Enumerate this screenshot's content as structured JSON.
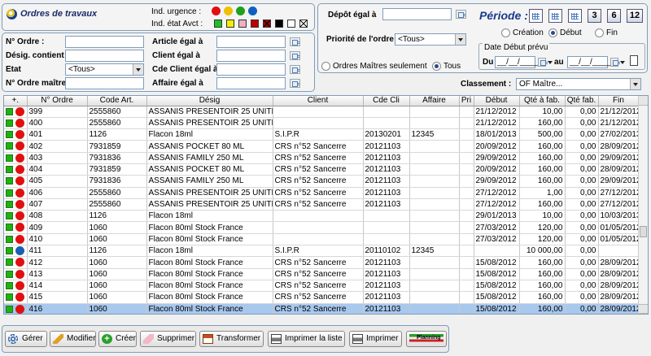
{
  "header": {
    "title": "Ordres de travaux",
    "urgence_label": "Ind. urgence :",
    "etat_label": "Ind. état Avct :",
    "urgence_colors": [
      "#e01010",
      "#f0c000",
      "#20a020",
      "#1060c0"
    ],
    "etat_colors": [
      "#20c020",
      "#f0f000",
      "#f0b0c0",
      "#c00000",
      "#a00000",
      "#000000",
      "#ffffff",
      "#ffffff"
    ]
  },
  "filters": {
    "ordre_label": "N° Ordre :",
    "desig_label": "Désig. contient",
    "etat_label": "Etat",
    "etat_value": "<Tous>",
    "ordre_maitre_label": "N° Ordre maître",
    "article_label": "Article égal à",
    "client_label": "Client égal à",
    "cde_client_label": "Cde Client égal à",
    "affaire_label": "Affaire égal à"
  },
  "depot": {
    "depot_label": "Dépôt égal à",
    "priorite_label": "Priorité de l'ordre :",
    "priorite_value": "<Tous>",
    "maitres_label": "Ordres Maîtres seulement",
    "tous_label": "Tous"
  },
  "periode": {
    "title": "Période :",
    "buttons": [
      "3",
      "6",
      "12"
    ],
    "creation_label": "Création",
    "debut_label": "Début",
    "fin_label": "Fin",
    "date_box_title": "Date Début prévu",
    "du_label": "Du",
    "au_label": "au",
    "du_value": "__/__/____",
    "au_value": "__/__/____"
  },
  "classement": {
    "label": "Classement :",
    "value": "OF Maître..."
  },
  "table": {
    "columns": [
      "+.",
      "N° Ordre",
      "Code Art.",
      "Désig",
      "Client",
      "Cde Cli",
      "Affaire",
      "Pri",
      "Début",
      "Qté à fab.",
      "Qté fab.",
      "Fin"
    ],
    "rows": [
      {
        "dot": "#e01010",
        "ordre": "399",
        "code": "2555860",
        "desig": "ASSANIS PRESENTOIR 25 UNITES",
        "client": "",
        "cde": "",
        "affaire": "",
        "pri": "",
        "debut": "21/12/2012",
        "qte": "10,00",
        "fab": "0,00",
        "fin": "21/12/2012"
      },
      {
        "dot": "#e01010",
        "ordre": "400",
        "code": "2555860",
        "desig": "ASSANIS PRESENTOIR 25 UNITES",
        "client": "",
        "cde": "",
        "affaire": "",
        "pri": "",
        "debut": "21/12/2012",
        "qte": "160,00",
        "fab": "0,00",
        "fin": "21/12/2012"
      },
      {
        "dot": "#e01010",
        "ordre": "401",
        "code": "1126",
        "desig": "Flacon 18ml",
        "client": "S.I.P.R",
        "cde": "20130201",
        "affaire": "12345",
        "pri": "",
        "debut": "18/01/2013",
        "qte": "500,00",
        "fab": "0,00",
        "fin": "27/02/2013"
      },
      {
        "dot": "#e01010",
        "ordre": "402",
        "code": "7931859",
        "desig": "ASSANIS POCKET 80 ML",
        "client": "CRS n°52 Sancerre",
        "cde": "20121103",
        "affaire": "",
        "pri": "",
        "debut": "20/09/2012",
        "qte": "160,00",
        "fab": "0,00",
        "fin": "28/09/2012"
      },
      {
        "dot": "#e01010",
        "ordre": "403",
        "code": "7931836",
        "desig": "ASSANIS FAMILY 250 ML",
        "client": "CRS n°52 Sancerre",
        "cde": "20121103",
        "affaire": "",
        "pri": "",
        "debut": "29/09/2012",
        "qte": "160,00",
        "fab": "0,00",
        "fin": "29/09/2012"
      },
      {
        "dot": "#e01010",
        "ordre": "404",
        "code": "7931859",
        "desig": "ASSANIS POCKET 80 ML",
        "client": "CRS n°52 Sancerre",
        "cde": "20121103",
        "affaire": "",
        "pri": "",
        "debut": "20/09/2012",
        "qte": "160,00",
        "fab": "0,00",
        "fin": "28/09/2012"
      },
      {
        "dot": "#e01010",
        "ordre": "405",
        "code": "7931836",
        "desig": "ASSANIS FAMILY 250 ML",
        "client": "CRS n°52 Sancerre",
        "cde": "20121103",
        "affaire": "",
        "pri": "",
        "debut": "29/09/2012",
        "qte": "160,00",
        "fab": "0,00",
        "fin": "29/09/2012"
      },
      {
        "dot": "#e01010",
        "ordre": "406",
        "code": "2555860",
        "desig": "ASSANIS PRESENTOIR 25 UNITES",
        "client": "CRS n°52 Sancerre",
        "cde": "20121103",
        "affaire": "",
        "pri": "",
        "debut": "27/12/2012",
        "qte": "1,00",
        "fab": "0,00",
        "fin": "27/12/2012"
      },
      {
        "dot": "#e01010",
        "ordre": "407",
        "code": "2555860",
        "desig": "ASSANIS PRESENTOIR 25 UNITES",
        "client": "CRS n°52 Sancerre",
        "cde": "20121103",
        "affaire": "",
        "pri": "",
        "debut": "27/12/2012",
        "qte": "160,00",
        "fab": "0,00",
        "fin": "27/12/2012"
      },
      {
        "dot": "#e01010",
        "ordre": "408",
        "code": "1126",
        "desig": "Flacon 18ml",
        "client": "",
        "cde": "",
        "affaire": "",
        "pri": "",
        "debut": "29/01/2013",
        "qte": "10,00",
        "fab": "0,00",
        "fin": "10/03/2013"
      },
      {
        "dot": "#e01010",
        "ordre": "409",
        "code": "1060",
        "desig": "Flacon 80ml Stock France",
        "client": "",
        "cde": "",
        "affaire": "",
        "pri": "",
        "debut": "27/03/2012",
        "qte": "120,00",
        "fab": "0,00",
        "fin": "01/05/2012"
      },
      {
        "dot": "#e01010",
        "ordre": "410",
        "code": "1060",
        "desig": "Flacon 80ml Stock France",
        "client": "",
        "cde": "",
        "affaire": "",
        "pri": "",
        "debut": "27/03/2012",
        "qte": "120,00",
        "fab": "0,00",
        "fin": "01/05/2012"
      },
      {
        "dot": "#1a5fb4",
        "ordre": "411",
        "code": "1126",
        "desig": "Flacon 18ml",
        "client": "S.I.P.R",
        "cde": "20110102",
        "affaire": "12345",
        "pri": "",
        "debut": "",
        "qte": "10 000,00",
        "fab": "0,00",
        "fin": ""
      },
      {
        "dot": "#e01010",
        "ordre": "412",
        "code": "1060",
        "desig": "Flacon 80ml Stock France",
        "client": "CRS n°52 Sancerre",
        "cde": "20121103",
        "affaire": "",
        "pri": "",
        "debut": "15/08/2012",
        "qte": "160,00",
        "fab": "0,00",
        "fin": "28/09/2012"
      },
      {
        "dot": "#e01010",
        "ordre": "413",
        "code": "1060",
        "desig": "Flacon 80ml Stock France",
        "client": "CRS n°52 Sancerre",
        "cde": "20121103",
        "affaire": "",
        "pri": "",
        "debut": "15/08/2012",
        "qte": "160,00",
        "fab": "0,00",
        "fin": "28/09/2012"
      },
      {
        "dot": "#e01010",
        "ordre": "414",
        "code": "1060",
        "desig": "Flacon 80ml Stock France",
        "client": "CRS n°52 Sancerre",
        "cde": "20121103",
        "affaire": "",
        "pri": "",
        "debut": "15/08/2012",
        "qte": "160,00",
        "fab": "0,00",
        "fin": "28/09/2012"
      },
      {
        "dot": "#e01010",
        "ordre": "415",
        "code": "1060",
        "desig": "Flacon 80ml Stock France",
        "client": "CRS n°52 Sancerre",
        "cde": "20121103",
        "affaire": "",
        "pri": "",
        "debut": "15/08/2012",
        "qte": "160,00",
        "fab": "0,00",
        "fin": "28/09/2012"
      },
      {
        "dot": "#e01010",
        "ordre": "416",
        "code": "1060",
        "desig": "Flacon 80ml Stock France",
        "client": "CRS n°52 Sancerre",
        "cde": "20121103",
        "affaire": "",
        "pri": "",
        "debut": "15/08/2012",
        "qte": "160,00",
        "fab": "0,00",
        "fin": "28/09/2012"
      }
    ],
    "selected_index": 17
  },
  "buttons": {
    "gerer": "Gérer",
    "modifier": "Modifier",
    "creer": "Créer",
    "supprimer": "Supprimer",
    "transformer": "Transformer",
    "imprimer_liste": "Imprimer la liste",
    "imprimer": "Imprimer",
    "planning": "Planning"
  }
}
